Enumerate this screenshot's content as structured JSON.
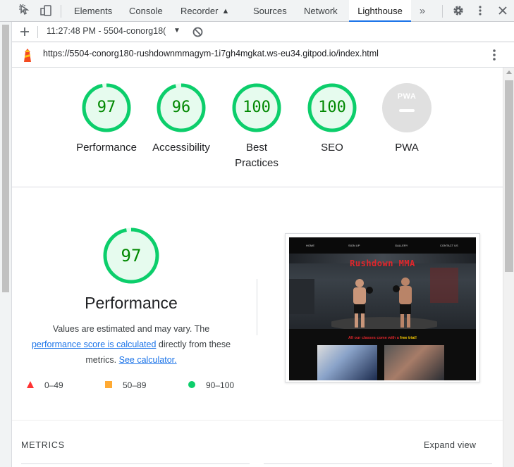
{
  "devtools": {
    "tabs": [
      {
        "label": "Elements"
      },
      {
        "label": "Console"
      },
      {
        "label": "Recorder"
      },
      {
        "label": "Sources"
      },
      {
        "label": "Network"
      },
      {
        "label": "Lighthouse"
      }
    ],
    "active_tab": "Lighthouse",
    "icons": [
      "inspect-cursor-icon",
      "device-toggle-icon",
      "recorder-flask-icon",
      "more-tabs-icon",
      "settings-gear-icon",
      "kebab-menu-icon",
      "close-icon"
    ]
  },
  "toolbar": {
    "report_selector": "11:27:48 PM - 5504-conorg18(",
    "icons": [
      "add-icon",
      "dropdown-arrow-icon",
      "clear-block-icon"
    ]
  },
  "urlbar": {
    "url": "https://5504-conorg180-rushdownmmagym-1i7gh4mgkat.ws-eu34.gitpod.io/index.html",
    "icons": [
      "lighthouse-logo-icon",
      "kebab-menu-icon"
    ]
  },
  "summary": {
    "scores": [
      {
        "label": "Performance",
        "value": "97",
        "fraction": 0.97
      },
      {
        "label": "Accessibility",
        "value": "96",
        "fraction": 0.96
      },
      {
        "label": "Best Practices",
        "value": "100",
        "fraction": 1.0
      },
      {
        "label": "SEO",
        "value": "100",
        "fraction": 1.0
      },
      {
        "label": "PWA",
        "value": "PWA"
      }
    ]
  },
  "performance": {
    "score": "97",
    "fraction": 0.97,
    "title": "Performance",
    "desc_1": "Values are estimated and may vary. The",
    "link_score": "performance score is calculated",
    "desc_2": "directly from these",
    "desc_3": "metrics.",
    "link_calc": "See calculator.",
    "legend": [
      {
        "range": "0–49",
        "color": "#ff3333"
      },
      {
        "range": "50–89",
        "color": "#ffaa33"
      },
      {
        "range": "90–100",
        "color": "#0cce6b"
      }
    ]
  },
  "screenshot": {
    "nav": [
      "HOME",
      "SIGN UP",
      "GALLERY",
      "CONTACT US"
    ],
    "brand": "Rushdown MMA",
    "tagline": "All our classes come with a",
    "tagline_highlight": "free trial!"
  },
  "metrics": {
    "heading": "METRICS",
    "expand": "Expand view"
  },
  "colors": {
    "pass": "#0cce6b",
    "pass_text": "#008800",
    "pass_fill": "#e6fbee",
    "pwa_gray": "#e0e0e0",
    "link": "#1a73e8",
    "brand_red": "#e0262b",
    "trial_yellow": "#ffd000"
  }
}
